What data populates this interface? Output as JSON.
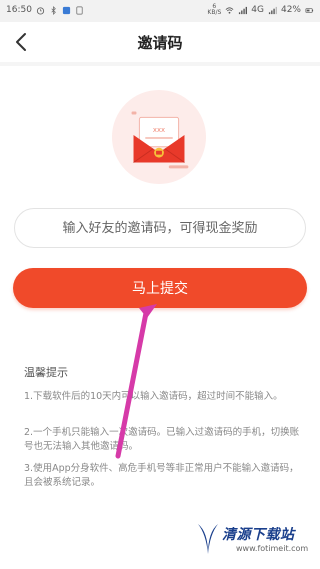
{
  "status_bar": {
    "time": "16:50",
    "net_speed_value": "6",
    "net_speed_unit": "KB/S",
    "network_type": "4G",
    "battery": "42%"
  },
  "header": {
    "title": "邀请码"
  },
  "invite": {
    "placeholder": "输入好友的邀请码，可得现金奖励",
    "submit_label": "马上提交"
  },
  "tips": {
    "title": "温馨提示",
    "items": [
      "1.下载软件后的10天内可以输入邀请码，超过时间不能输入。",
      "2.一个手机只能输入一次邀请码。已输入过邀请码的手机，切换账号也无法输入其他邀请码。",
      "3.使用App分身软件、高危手机号等非正常用户不能输入邀请码，且会被系统记录。"
    ]
  },
  "watermark": {
    "name": "清源下载站",
    "url": "www.fotimeit.com"
  },
  "colors": {
    "accent": "#f04a2a",
    "annotation_arrow": "#d63aa8"
  }
}
